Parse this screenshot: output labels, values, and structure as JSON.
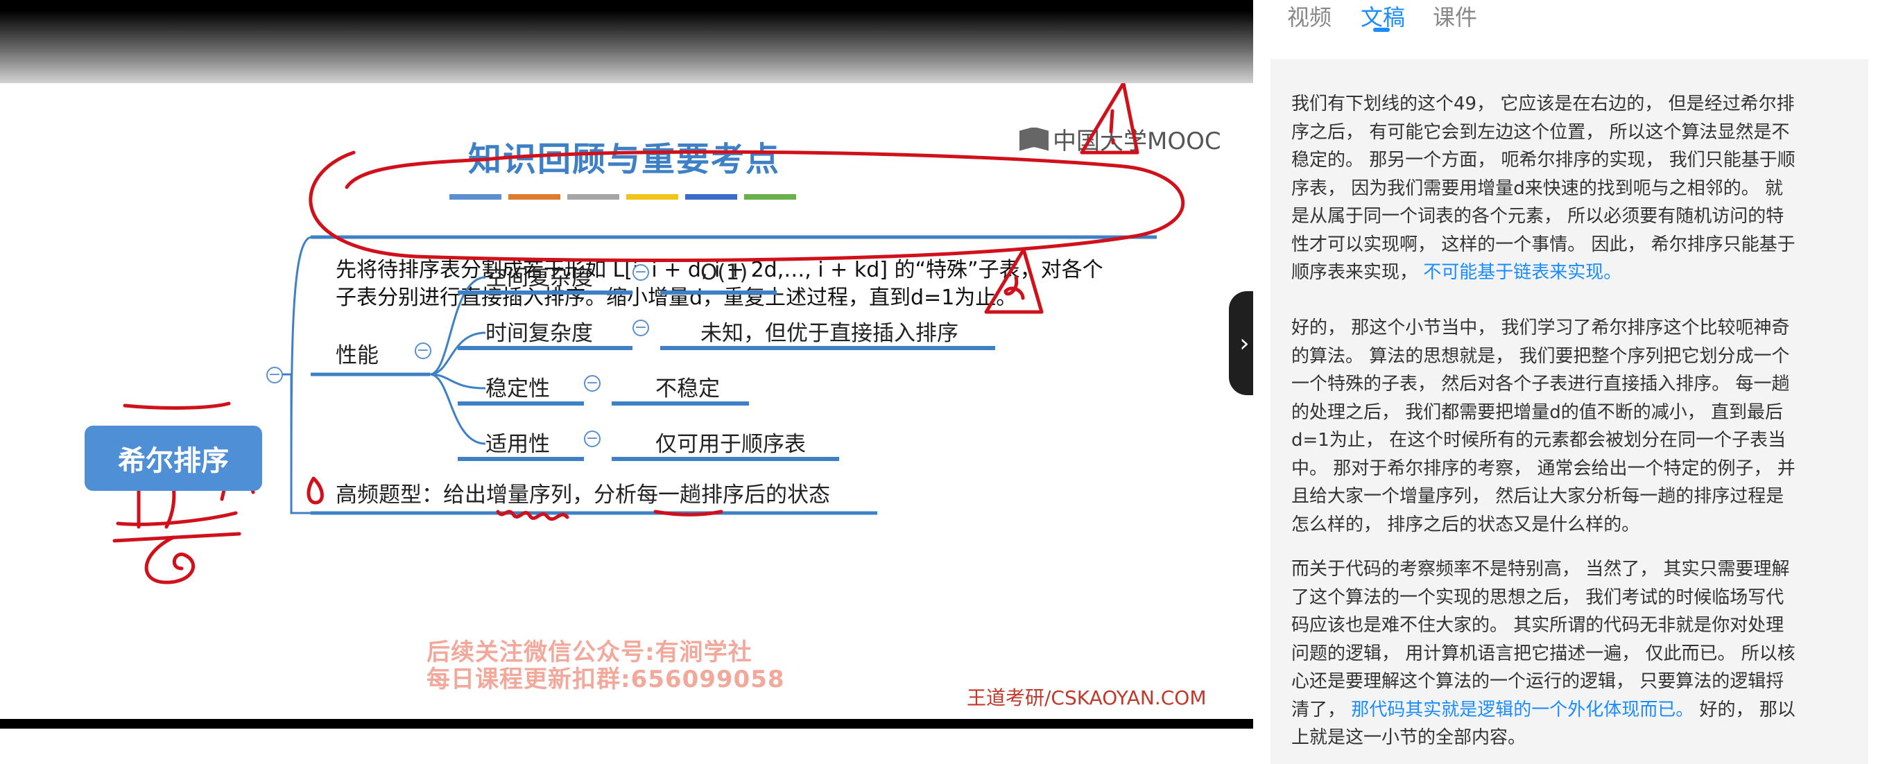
{
  "slide": {
    "title": "知识回顾与重要考点",
    "logo": "中国大学MOOC",
    "title_strip_colors": [
      "#5b8fd0",
      "#e07b2e",
      "#a6a6a6",
      "#f0c419",
      "#3b6cc7",
      "#6ab04c"
    ],
    "definition_line1": "先将待排序表分割成若干形如 L[i, i + d, i + 2d,…, i + kd] 的“特殊”子表，对各个",
    "definition_line2": "子表分别进行直接插入排序。缩小增量d，重复上述过程，直到d=1为止。",
    "root": "希尔排序",
    "performance_label": "性能",
    "collapse_symbol": "−",
    "props": [
      {
        "label": "空间复杂度",
        "value": "O(1)"
      },
      {
        "label": "时间复杂度",
        "value": "未知，但优于直接插入排序"
      },
      {
        "label": "稳定性",
        "value": "不稳定"
      },
      {
        "label": "适用性",
        "value": "仅可用于顺序表"
      }
    ],
    "exam_point": "高频题型：给出增量序列，分析每一趟排序后的状态",
    "promo_line1": "后续关注微信公众号:有涧学社",
    "promo_line2": "每日课程更新扣群:656099058",
    "watermark": "王道考研/CSKAOYAN.COM",
    "annotation_color": "#d0101a",
    "accent_color": "#3d80c6"
  },
  "panel": {
    "tabs": [
      {
        "label": "视频",
        "active": false
      },
      {
        "label": "文稿",
        "active": true
      },
      {
        "label": "课件",
        "active": false
      }
    ],
    "toggle_icon": "›",
    "paragraphs": [
      {
        "lines": [
          "我们有下划线的这个49， 它应该是在右边的， 但是经过希尔排",
          "序之后， 有可能它会到左边这个位置， 所以这个算法显然是不",
          "稳定的。 那另一个方面， 呃希尔排序的实现， 我们只能基于顺",
          "序表， 因为我们需要用增量d来快速的找到呃与之相邻的。 就",
          "是从属于同一个词表的各个元素， 所以必须要有随机访问的特",
          "性才可以实现啊， 这样的一个事情。 因此， 希尔排序只能基于"
        ],
        "last_plain": "顺序表来实现，",
        "last_highlight": "不可能基于链表来实现。",
        "last_tail": ""
      },
      {
        "lines": [
          "好的， 那这个小节当中， 我们学习了希尔排序这个比较呃神奇",
          "的算法。 算法的思想就是， 我们要把整个序列把它划分成一个",
          "一个特殊的子表， 然后对各个子表进行直接插入排序。 每一趟",
          "的处理之后， 我们都需要把增量d的值不断的减小， 直到最后",
          "d=1为止， 在这个时候所有的元素都会被划分在同一个子表当",
          "中。 那对于希尔排序的考察， 通常会给出一个特定的例子， 并",
          "且给大家一个增量序列， 然后让大家分析每一趟的排序过程是"
        ],
        "last_plain": "怎么样的， 排序之后的状态又是什么样的。",
        "last_highlight": "",
        "last_tail": ""
      },
      {
        "lines": [
          "而关于代码的考察频率不是特别高， 当然了， 其实只需要理解",
          "了这个算法的一个实现的思想之后， 我们考试的时候临场写代",
          "码应该也是难不住大家的。 其实所谓的代码无非就是你对处理",
          "问题的逻辑， 用计算机语言把它描述一遍， 仅此而已。 所以核",
          "心还是要理解这个算法的一个运行的逻辑， 只要算法的逻辑捋"
        ],
        "last_plain": "清了，",
        "last_highlight": "那代码其实就是逻辑的一个外化体现而已。",
        "last_tail": " 好的， 那以",
        "extra_line": "上就是这一小节的全部内容。"
      }
    ]
  }
}
